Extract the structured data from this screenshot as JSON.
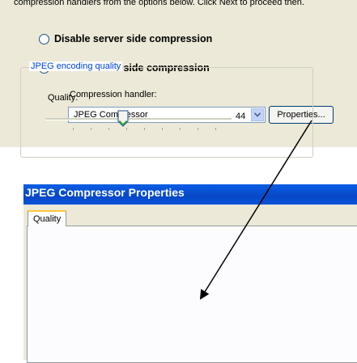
{
  "wizard": {
    "intro_text": "compression handlers from the options below. Click Next to proceed then.",
    "options": [
      {
        "label": "Disable server side compression",
        "selected": false
      },
      {
        "label": "Enable server side compression",
        "selected": true
      }
    ],
    "handler_label": "Compression handler:",
    "handler_value": "JPEG Compressor",
    "dropdown_icon": "chevron-down-icon",
    "properties_label": "Properties..."
  },
  "dialog": {
    "title": "JPEG Compressor Properties",
    "tabs": [
      {
        "label": "Quality",
        "active": true
      }
    ],
    "group_title": "JPEG encoding quality",
    "quality_label": "Quality:",
    "quality_value": "44",
    "slider_level": 44
  },
  "colors": {
    "window_bg": "#ece9d8",
    "titlebar": "#0747c8",
    "radio_checked": "#21a121",
    "group_title": "#0046d5",
    "annotation_arrow": "#000000"
  }
}
